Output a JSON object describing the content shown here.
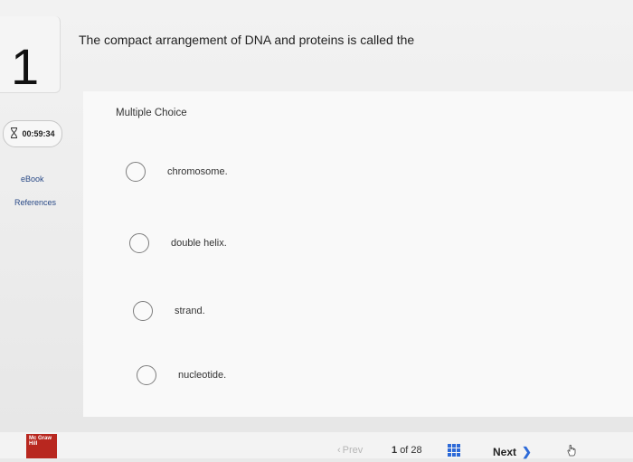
{
  "question": {
    "number": "1",
    "text": "The compact arrangement of DNA and proteins is called the"
  },
  "sidebar": {
    "timer": "00:59:34",
    "links": [
      "eBook",
      "References"
    ]
  },
  "question_type": "Multiple Choice",
  "choices": [
    "chromosome.",
    "double helix.",
    "strand.",
    "nucleotide."
  ],
  "footer": {
    "logo_text": "Mc Graw Hill",
    "prev_label": "Prev",
    "page_current": "1",
    "page_of": "of 28",
    "next_label": "Next",
    "icons": [
      "hourglass-icon",
      "grid-icon",
      "hand-pointer-icon",
      "chevron-right-icon"
    ],
    "colors": {
      "accent": "#2d6ad8",
      "logo_red": "#b8271f"
    }
  }
}
